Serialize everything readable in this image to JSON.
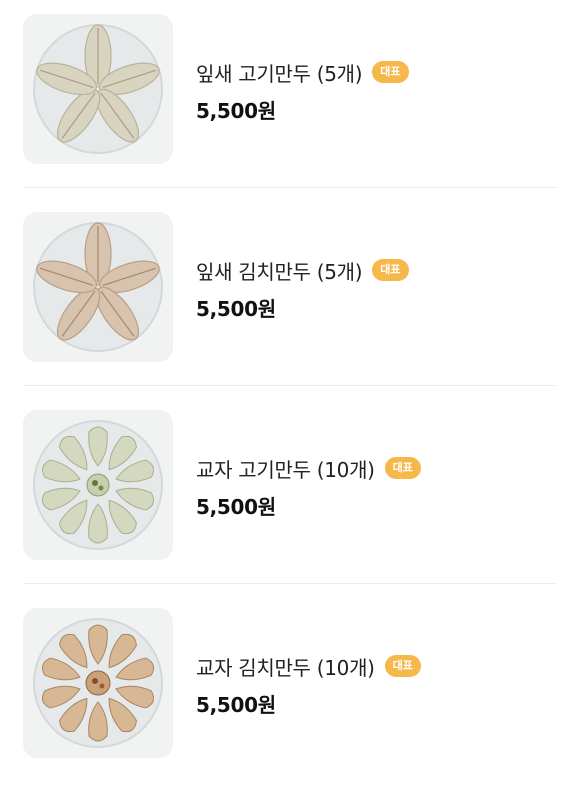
{
  "menu": {
    "items": [
      {
        "name": "잎새 고기만두 (5개)",
        "badge": "대표",
        "price": "5,500원",
        "image_icon": "leaf-dumpling-meat-plate",
        "dumpling_color": "#d8d4c0"
      },
      {
        "name": "잎새 김치만두 (5개)",
        "badge": "대표",
        "price": "5,500원",
        "image_icon": "leaf-dumpling-kimchi-plate",
        "dumpling_color": "#d7c3ae"
      },
      {
        "name": "교자 고기만두 (10개)",
        "badge": "대표",
        "price": "5,500원",
        "image_icon": "gyoza-meat-plate",
        "dumpling_color": "#d4d8bf"
      },
      {
        "name": "교자 김치만두 (10개)",
        "badge": "대표",
        "price": "5,500원",
        "image_icon": "gyoza-kimchi-plate",
        "dumpling_color": "#d8b894"
      }
    ]
  }
}
